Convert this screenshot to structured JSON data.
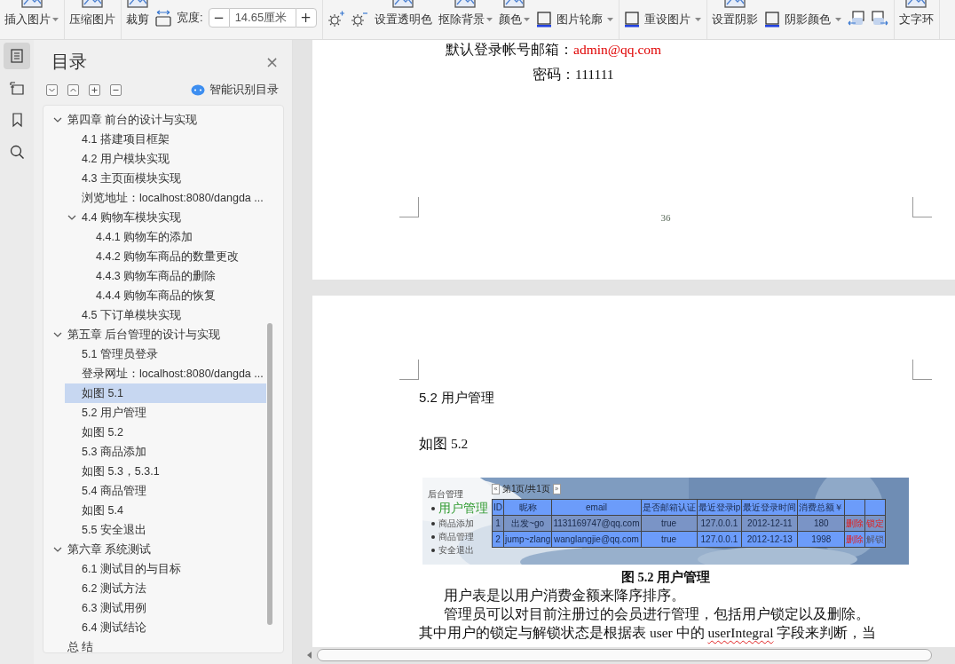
{
  "toolbar": {
    "groups": [
      {
        "items": [
          {
            "kind": "large",
            "label": "插入图片",
            "dropdown": true
          }
        ]
      },
      {
        "items": [
          {
            "kind": "large",
            "label": "压缩图片",
            "dropdown": false
          }
        ]
      },
      {
        "items": [
          {
            "kind": "large",
            "label": "裁剪",
            "dropdown": false
          },
          {
            "kind": "spinner",
            "label": "宽度:",
            "value": "14.65厘米",
            "decrement": "−",
            "increment": "+"
          }
        ]
      },
      {
        "items": [
          {
            "kind": "icon-pair"
          },
          {
            "kind": "large",
            "label": "设置透明色",
            "dropdown": false
          },
          {
            "kind": "large",
            "label": "抠除背景",
            "dropdown": true
          },
          {
            "kind": "large",
            "label": "颜色",
            "dropdown": true
          },
          {
            "kind": "small",
            "label": "图片轮廓",
            "dropdown": true
          }
        ]
      },
      {
        "items": [
          {
            "kind": "small",
            "label": "重设图片",
            "dropdown": true
          }
        ]
      },
      {
        "items": [
          {
            "kind": "large",
            "label": "设置阴影",
            "dropdown": false
          },
          {
            "kind": "small",
            "label": "阴影颜色",
            "dropdown": true
          },
          {
            "kind": "icon-pair"
          }
        ]
      },
      {
        "items": [
          {
            "kind": "large",
            "label": "文字环",
            "dropdown": false
          }
        ]
      }
    ]
  },
  "rail": [
    {
      "kind": "toc",
      "selected": true
    },
    {
      "kind": "outline",
      "selected": false
    },
    {
      "kind": "bookmark",
      "selected": false
    },
    {
      "kind": "search",
      "selected": false
    }
  ],
  "toc": {
    "title": "目录",
    "close": "×",
    "smart_button": "智能识别目录",
    "items": [
      {
        "label": "第四章  前台的设计与实现",
        "expanded": true,
        "selected": false,
        "children": [
          {
            "label": "4.1  搭建项目框架",
            "selected": false
          },
          {
            "label": "4.2  用户模块实现",
            "selected": false
          },
          {
            "label": "4.3  主页面模块实现",
            "selected": false
          },
          {
            "label": "浏览地址：localhost:8080/dangda ...",
            "selected": false
          },
          {
            "label": "4.4  购物车模块实现",
            "expanded": true,
            "selected": false,
            "children": [
              {
                "label": "4.4.1  购物车的添加",
                "selected": false
              },
              {
                "label": "4.4.2  购物车商品的数量更改",
                "selected": false
              },
              {
                "label": "4.4.3  购物车商品的删除",
                "selected": false
              },
              {
                "label": "4.4.4  购物车商品的恢复",
                "selected": false
              }
            ]
          },
          {
            "label": "4.5  下订单模块实现",
            "selected": false
          }
        ]
      },
      {
        "label": "第五章  后台管理的设计与实现",
        "expanded": true,
        "selected": false,
        "children": [
          {
            "label": "5.1 管理员登录",
            "selected": false
          },
          {
            "label": "登录网址：localhost:8080/dangda ...",
            "selected": false
          },
          {
            "label": "如图 5.1",
            "selected": true
          },
          {
            "label": "5.2  用户管理",
            "selected": false
          },
          {
            "label": "如图 5.2",
            "selected": false
          },
          {
            "label": "5.3  商品添加",
            "selected": false
          },
          {
            "label": "如图 5.3，5.3.1",
            "selected": false
          },
          {
            "label": "5.4  商品管理",
            "selected": false
          },
          {
            "label": "如图 5.4",
            "selected": false
          },
          {
            "label": "5.5  安全退出",
            "selected": false
          }
        ]
      },
      {
        "label": "第六章  系统测试",
        "expanded": true,
        "selected": false,
        "children": [
          {
            "label": "6.1  测试目的与目标",
            "selected": false
          },
          {
            "label": "6.2  测试方法",
            "selected": false
          },
          {
            "label": "6.3  测试用例",
            "selected": false
          },
          {
            "label": "6.4  测试结论",
            "selected": false
          }
        ]
      },
      {
        "label": "总    结",
        "selected": false
      }
    ]
  },
  "pages": [
    {
      "lines": [
        [
          {
            "text": "默认登录帐号邮箱：",
            "emphasis": false
          },
          {
            "text": "admin@qq.com",
            "emphasis": true
          }
        ],
        [
          {
            "text": "密码：111111",
            "emphasis": false
          }
        ]
      ],
      "page_number": "36"
    },
    {
      "heading": "5.2  用户管理",
      "figure_ref": "如图 5.2",
      "figure": {
        "menu_title": "后台管理",
        "menu": [
          {
            "label": "用户管理",
            "selected": true
          },
          {
            "label": "商品添加",
            "selected": false
          },
          {
            "label": "商品管理",
            "selected": false
          },
          {
            "label": "安全退出",
            "selected": false
          }
        ],
        "pager": {
          "prev": "«",
          "label": "第1页/共1页",
          "next": "»"
        },
        "columns": [
          "ID",
          "昵称",
          "email",
          "是否邮箱认证",
          "最近登录ip",
          "最近登录时间",
          "消费总额￥"
        ],
        "rows": [
          {
            "cells": [
              "1",
              "出发~go",
              "1131169747@qq.com",
              "true",
              "127.0.0.1",
              "2012-12-11",
              "180"
            ],
            "actions": [
              {
                "label": "删除",
                "kind": "delete"
              },
              {
                "label": "锁定",
                "kind": "lock"
              }
            ]
          },
          {
            "cells": [
              "2",
              "jump~zlang",
              "wanglangjie@qq.com",
              "true",
              "127.0.0.1",
              "2012-12-13",
              "1998"
            ],
            "actions": [
              {
                "label": "删除",
                "kind": "delete"
              },
              {
                "label": "解锁",
                "kind": "unlock"
              }
            ]
          }
        ]
      },
      "caption": "图 5.2 用户管理",
      "paragraphs": [
        {
          "indent": true,
          "segments": [
            {
              "text": "用户表是以用户消费金额来降序排序。",
              "misspelled": false
            }
          ]
        },
        {
          "indent": true,
          "segments": [
            {
              "text": "管理员可以对目前注册过的会员进行管理，包括用户锁定以及删除。",
              "misspelled": false
            }
          ]
        },
        {
          "indent": false,
          "segments": [
            {
              "text": "其中用户的锁定与解锁状态是根据表 user 中的 ",
              "misspelled": false
            },
            {
              "text": "userIntegral",
              "misspelled": true
            },
            {
              "text": " 字段来判断，当",
              "misspelled": false
            }
          ]
        }
      ]
    }
  ]
}
